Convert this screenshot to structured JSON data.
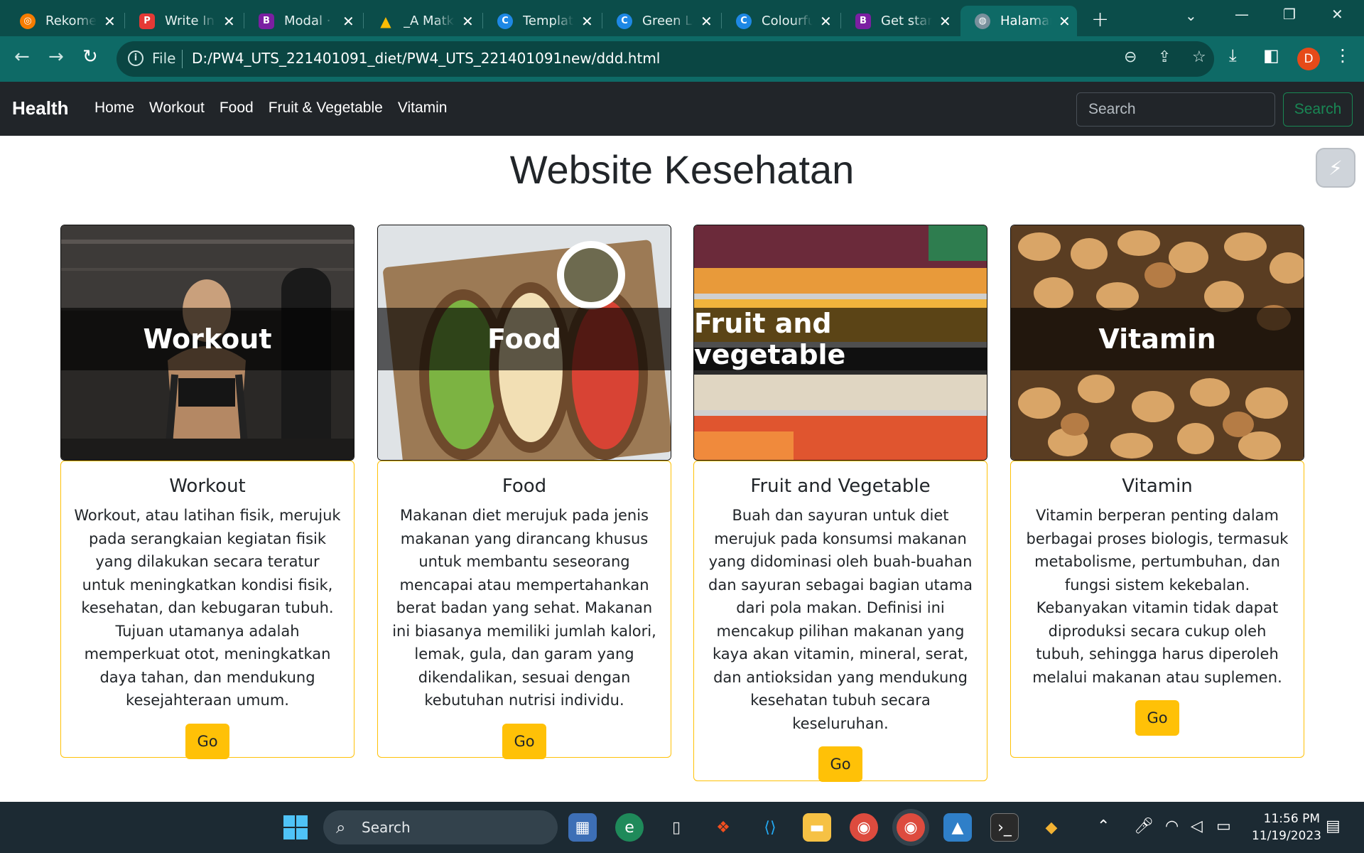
{
  "browser": {
    "tabs": [
      {
        "title": "Rekomendasi",
        "icon": "swirl-icon",
        "color": "#f57c00"
      },
      {
        "title": "Write In",
        "icon": "p-icon",
        "color": "#e53935"
      },
      {
        "title": "Modal · Bootstrap",
        "icon": "bootstrap-icon",
        "color": "#7b1fa2"
      },
      {
        "title": "_A Matkul",
        "icon": "drive-icon",
        "color": "#0f9d58"
      },
      {
        "title": "Template",
        "icon": "canva-icon",
        "color": "#1e88e5"
      },
      {
        "title": "Green Leaf",
        "icon": "canva-icon",
        "color": "#1e88e5"
      },
      {
        "title": "Colourful",
        "icon": "canva-icon",
        "color": "#1e88e5"
      },
      {
        "title": "Get started",
        "icon": "bootstrap-icon",
        "color": "#7b1fa2"
      },
      {
        "title": "Halaman",
        "icon": "globe-icon",
        "color": "#546e7a"
      }
    ],
    "address": {
      "scheme_label": "File",
      "url": "D:/PW4_UTS_221401091_diet/PW4_UTS_221401091new/ddd.html"
    },
    "profile_initial": "D"
  },
  "navbar": {
    "brand": "Health",
    "links": [
      "Home",
      "Workout",
      "Food",
      "Fruit & Vegetable",
      "Vitamin"
    ],
    "search_placeholder": "Search",
    "search_button": "Search"
  },
  "page_title": "Website Kesehatan",
  "cards": [
    {
      "overlay": "Workout",
      "title": "Workout",
      "text": "Workout, atau latihan fisik, merujuk pada serangkaian kegiatan fisik yang dilakukan secara teratur untuk meningkatkan kondisi fisik, kesehatan, dan kebugaran tubuh. Tujuan utamanya adalah memperkuat otot, meningkatkan daya tahan, dan mendukung kesejahteraan umum.",
      "button": "Go"
    },
    {
      "overlay": "Food",
      "title": "Food",
      "text": "Makanan diet merujuk pada jenis makanan yang dirancang khusus untuk membantu seseorang mencapai atau mempertahankan berat badan yang sehat. Makanan ini biasanya memiliki jumlah kalori, lemak, gula, dan garam yang dikendalikan, sesuai dengan kebutuhan nutrisi individu.",
      "button": "Go"
    },
    {
      "overlay": "Fruit and vegetable",
      "title": "Fruit and Vegetable",
      "text": "Buah dan sayuran untuk diet merujuk pada konsumsi makanan yang didominasi oleh buah-buahan dan sayuran sebagai bagian utama dari pola makan. Definisi ini mencakup pilihan makanan yang kaya akan vitamin, mineral, serat, dan antioksidan yang mendukung kesehatan tubuh secara keseluruhan.",
      "button": "Go"
    },
    {
      "overlay": "Vitamin",
      "title": "Vitamin",
      "text": "Vitamin berperan penting dalam berbagai proses biologis, termasuk metabolisme, pertumbuhan, dan fungsi sistem kekebalan. Kebanyakan vitamin tidak dapat diproduksi secara cukup oleh tubuh, sehingga harus diperoleh melalui makanan atau suplemen.",
      "button": "Go"
    }
  ],
  "taskbar": {
    "search_label": "Search",
    "time": "11:56 PM",
    "date": "11/19/2023"
  }
}
